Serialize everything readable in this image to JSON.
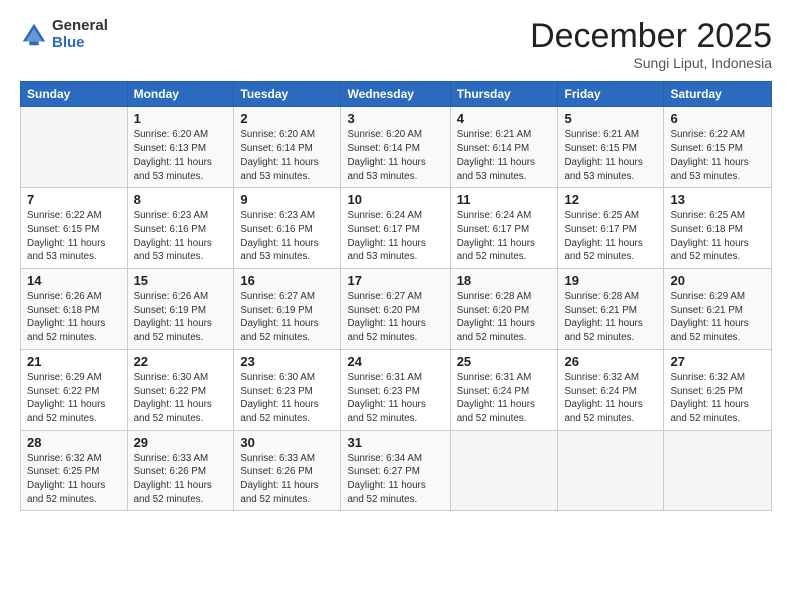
{
  "logo": {
    "general": "General",
    "blue": "Blue"
  },
  "header": {
    "month": "December 2025",
    "location": "Sungi Liput, Indonesia"
  },
  "weekdays": [
    "Sunday",
    "Monday",
    "Tuesday",
    "Wednesday",
    "Thursday",
    "Friday",
    "Saturday"
  ],
  "weeks": [
    [
      {
        "day": "",
        "info": ""
      },
      {
        "day": "1",
        "info": "Sunrise: 6:20 AM\nSunset: 6:13 PM\nDaylight: 11 hours\nand 53 minutes."
      },
      {
        "day": "2",
        "info": "Sunrise: 6:20 AM\nSunset: 6:14 PM\nDaylight: 11 hours\nand 53 minutes."
      },
      {
        "day": "3",
        "info": "Sunrise: 6:20 AM\nSunset: 6:14 PM\nDaylight: 11 hours\nand 53 minutes."
      },
      {
        "day": "4",
        "info": "Sunrise: 6:21 AM\nSunset: 6:14 PM\nDaylight: 11 hours\nand 53 minutes."
      },
      {
        "day": "5",
        "info": "Sunrise: 6:21 AM\nSunset: 6:15 PM\nDaylight: 11 hours\nand 53 minutes."
      },
      {
        "day": "6",
        "info": "Sunrise: 6:22 AM\nSunset: 6:15 PM\nDaylight: 11 hours\nand 53 minutes."
      }
    ],
    [
      {
        "day": "7",
        "info": "Sunrise: 6:22 AM\nSunset: 6:15 PM\nDaylight: 11 hours\nand 53 minutes."
      },
      {
        "day": "8",
        "info": "Sunrise: 6:23 AM\nSunset: 6:16 PM\nDaylight: 11 hours\nand 53 minutes."
      },
      {
        "day": "9",
        "info": "Sunrise: 6:23 AM\nSunset: 6:16 PM\nDaylight: 11 hours\nand 53 minutes."
      },
      {
        "day": "10",
        "info": "Sunrise: 6:24 AM\nSunset: 6:17 PM\nDaylight: 11 hours\nand 53 minutes."
      },
      {
        "day": "11",
        "info": "Sunrise: 6:24 AM\nSunset: 6:17 PM\nDaylight: 11 hours\nand 52 minutes."
      },
      {
        "day": "12",
        "info": "Sunrise: 6:25 AM\nSunset: 6:17 PM\nDaylight: 11 hours\nand 52 minutes."
      },
      {
        "day": "13",
        "info": "Sunrise: 6:25 AM\nSunset: 6:18 PM\nDaylight: 11 hours\nand 52 minutes."
      }
    ],
    [
      {
        "day": "14",
        "info": "Sunrise: 6:26 AM\nSunset: 6:18 PM\nDaylight: 11 hours\nand 52 minutes."
      },
      {
        "day": "15",
        "info": "Sunrise: 6:26 AM\nSunset: 6:19 PM\nDaylight: 11 hours\nand 52 minutes."
      },
      {
        "day": "16",
        "info": "Sunrise: 6:27 AM\nSunset: 6:19 PM\nDaylight: 11 hours\nand 52 minutes."
      },
      {
        "day": "17",
        "info": "Sunrise: 6:27 AM\nSunset: 6:20 PM\nDaylight: 11 hours\nand 52 minutes."
      },
      {
        "day": "18",
        "info": "Sunrise: 6:28 AM\nSunset: 6:20 PM\nDaylight: 11 hours\nand 52 minutes."
      },
      {
        "day": "19",
        "info": "Sunrise: 6:28 AM\nSunset: 6:21 PM\nDaylight: 11 hours\nand 52 minutes."
      },
      {
        "day": "20",
        "info": "Sunrise: 6:29 AM\nSunset: 6:21 PM\nDaylight: 11 hours\nand 52 minutes."
      }
    ],
    [
      {
        "day": "21",
        "info": "Sunrise: 6:29 AM\nSunset: 6:22 PM\nDaylight: 11 hours\nand 52 minutes."
      },
      {
        "day": "22",
        "info": "Sunrise: 6:30 AM\nSunset: 6:22 PM\nDaylight: 11 hours\nand 52 minutes."
      },
      {
        "day": "23",
        "info": "Sunrise: 6:30 AM\nSunset: 6:23 PM\nDaylight: 11 hours\nand 52 minutes."
      },
      {
        "day": "24",
        "info": "Sunrise: 6:31 AM\nSunset: 6:23 PM\nDaylight: 11 hours\nand 52 minutes."
      },
      {
        "day": "25",
        "info": "Sunrise: 6:31 AM\nSunset: 6:24 PM\nDaylight: 11 hours\nand 52 minutes."
      },
      {
        "day": "26",
        "info": "Sunrise: 6:32 AM\nSunset: 6:24 PM\nDaylight: 11 hours\nand 52 minutes."
      },
      {
        "day": "27",
        "info": "Sunrise: 6:32 AM\nSunset: 6:25 PM\nDaylight: 11 hours\nand 52 minutes."
      }
    ],
    [
      {
        "day": "28",
        "info": "Sunrise: 6:32 AM\nSunset: 6:25 PM\nDaylight: 11 hours\nand 52 minutes."
      },
      {
        "day": "29",
        "info": "Sunrise: 6:33 AM\nSunset: 6:26 PM\nDaylight: 11 hours\nand 52 minutes."
      },
      {
        "day": "30",
        "info": "Sunrise: 6:33 AM\nSunset: 6:26 PM\nDaylight: 11 hours\nand 52 minutes."
      },
      {
        "day": "31",
        "info": "Sunrise: 6:34 AM\nSunset: 6:27 PM\nDaylight: 11 hours\nand 52 minutes."
      },
      {
        "day": "",
        "info": ""
      },
      {
        "day": "",
        "info": ""
      },
      {
        "day": "",
        "info": ""
      }
    ]
  ]
}
